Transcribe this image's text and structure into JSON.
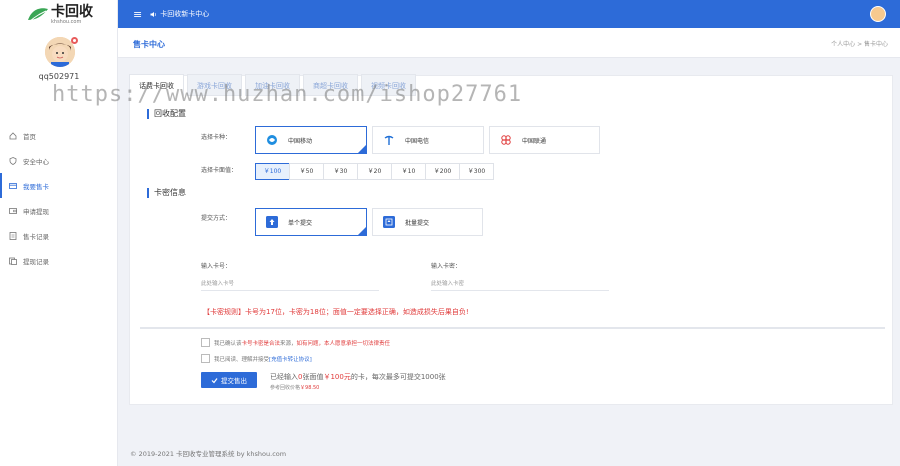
{
  "brand": {
    "name": "卡回收",
    "domain": "khshou.com"
  },
  "user": {
    "name": "qq502971"
  },
  "sidebar": {
    "items": [
      {
        "label": "首页",
        "icon": "home-icon"
      },
      {
        "label": "安全中心",
        "icon": "shield-icon"
      },
      {
        "label": "我要售卡",
        "icon": "card-icon",
        "active": true
      },
      {
        "label": "申请提现",
        "icon": "wallet-icon"
      },
      {
        "label": "售卡记录",
        "icon": "record-icon"
      },
      {
        "label": "提现记录",
        "icon": "list-icon"
      }
    ]
  },
  "topbar": {
    "crumb": "卡回收新卡中心"
  },
  "page": {
    "title": "售卡中心",
    "breadcrumb": "个人中心  >  售卡中心"
  },
  "tabs": [
    "话费卡回收",
    "游戏卡回收",
    "加油卡回收",
    "商超卡回收",
    "视频卡回收"
  ],
  "recycle": {
    "section_title": "回收配置",
    "card_type_label": "选择卡种：",
    "carriers": [
      "中国移动",
      "中国电信",
      "中国联通"
    ],
    "denomination_label": "选择卡面值：",
    "denominations": [
      "￥100",
      "￥50",
      "￥30",
      "￥20",
      "￥10",
      "￥200",
      "￥300"
    ]
  },
  "card_info": {
    "section_title": "卡密信息",
    "submit_mode_label": "提交方式：",
    "modes": [
      "单个提交",
      "批量提交"
    ],
    "card_no_label": "输入卡号：",
    "card_no_placeholder": "此处输入卡号",
    "card_pwd_label": "输入卡密：",
    "card_pwd_placeholder": "此处输入卡密"
  },
  "rules": {
    "prefix": "【卡密规则】",
    "text": "卡号为17位，卡密为18位；面值一定要选择正确，如造成损失后果自负!"
  },
  "agreements": [
    {
      "pre": "我已确认该",
      "red": "卡号卡密是合法",
      "mid": "来源，",
      "red2": "如有问题，本人愿意承担一切法律责任",
      "post": ""
    },
    {
      "pre": "我已阅读、理解并接受",
      "link": "[充值卡转让协议]",
      "post": ""
    }
  ],
  "submit": {
    "label": "提交售出",
    "summary_pre": "已经输入",
    "count": "0",
    "summary_mid": "张面值",
    "face": "￥100元",
    "summary_post": "的卡，每次最多可提交1000张",
    "ref_label": "参考回收价格",
    "ref_price": "￥98.50"
  },
  "footer": {
    "text": "© 2019-2021 卡回收专业管理系统 by khshou.com"
  },
  "watermark": "https://www.huzhan.com/ishop27761",
  "colors": {
    "accent": "#2d6bd8",
    "danger": "#e03a3a"
  }
}
